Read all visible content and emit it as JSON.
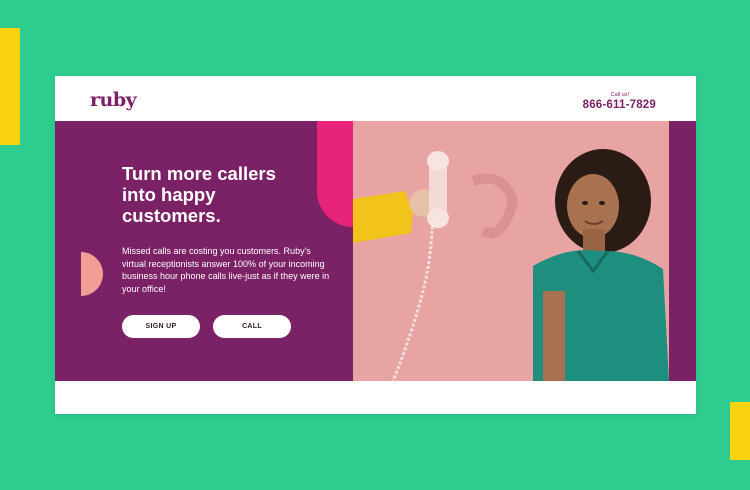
{
  "header": {
    "logo": "ruby",
    "call_label": "Call us!",
    "phone": "866-611-7829"
  },
  "hero": {
    "headline": "Turn more callers into happy customers.",
    "body": "Missed calls are costing you customers. Ruby's virtual receptionists answer 100% of your incoming business hour phone calls live-just as if they were in your office!",
    "signup_label": "SIGN UP",
    "call_label": "CALL"
  },
  "colors": {
    "background": "#2ecc8e",
    "accent_yellow": "#f9d210",
    "brand_purple": "#7b2166",
    "brand_pink": "#e8247a",
    "photo_background": "#e8a3a3"
  }
}
